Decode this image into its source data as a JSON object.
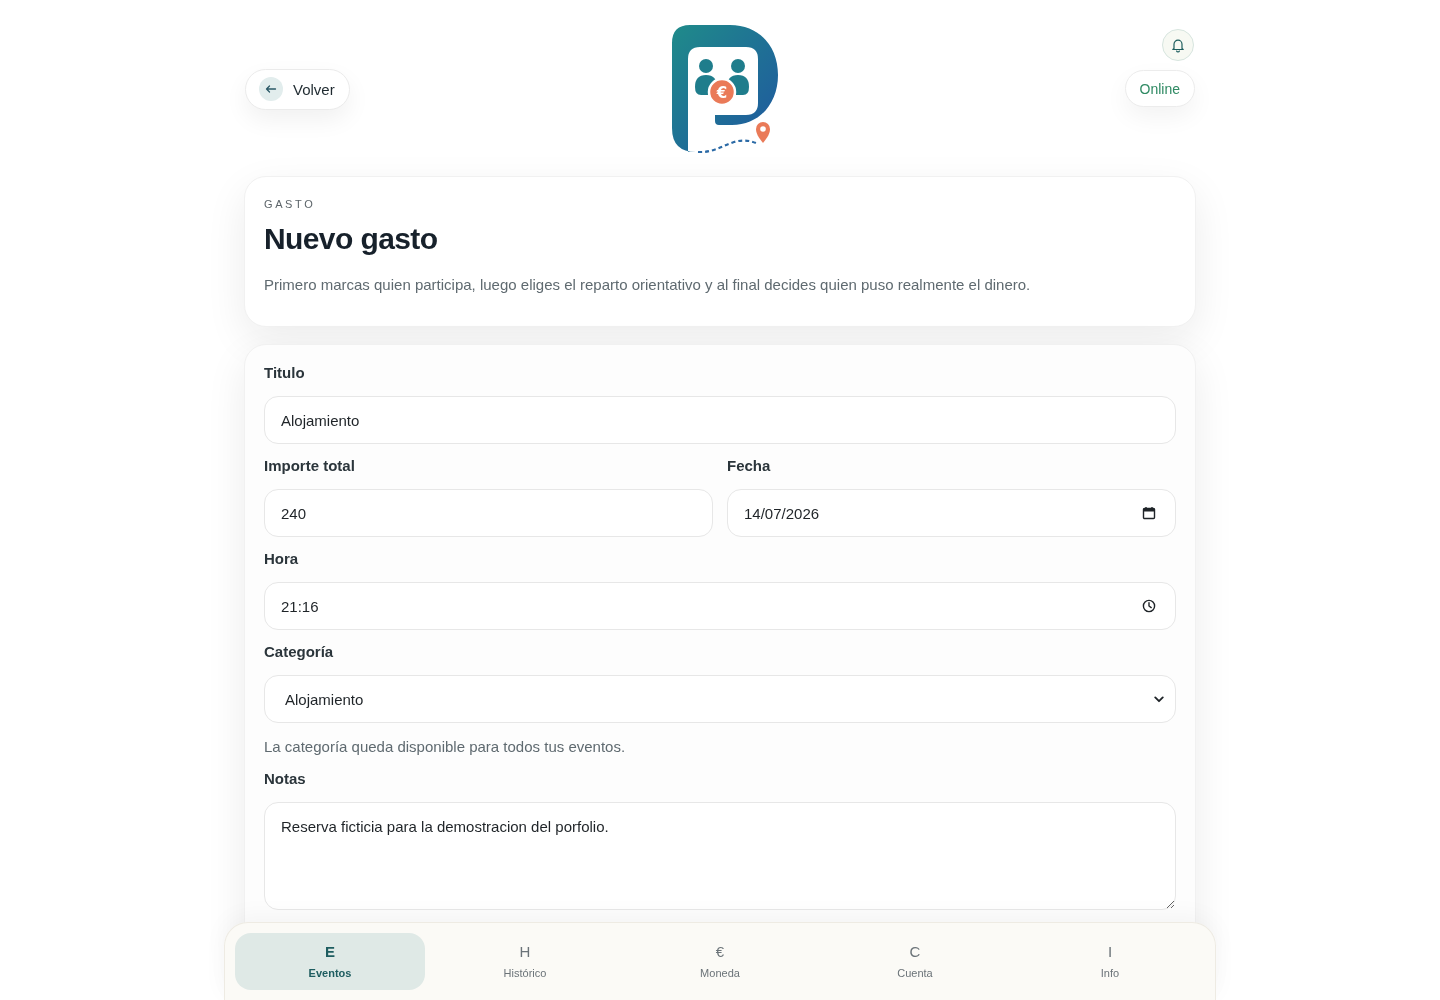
{
  "header": {
    "back_button": {
      "label": "Volver"
    },
    "logo": {
      "symbol": "€"
    },
    "status": {
      "label": "Online"
    }
  },
  "intro": {
    "eyebrow": "GASTO",
    "title": "Nuevo gasto",
    "description": "Primero marcas quien participa, luego eliges el reparto orientativo y al final decides quien puso realmente el dinero."
  },
  "form": {
    "rows": [
      {
        "fields": [
          {
            "kind": "text",
            "label": "Titulo",
            "value": "Alojamiento"
          }
        ]
      },
      {
        "fields": [
          {
            "kind": "text",
            "label": "Importe total",
            "value": "240"
          },
          {
            "kind": "date",
            "label": "Fecha",
            "value": "14/07/2026"
          }
        ]
      },
      {
        "fields": [
          {
            "kind": "time",
            "label": "Hora",
            "value": "21:16"
          }
        ]
      },
      {
        "fields": [
          {
            "kind": "select",
            "label": "Categoría",
            "value": "Alojamiento",
            "hint": "La categoría queda disponible para todos tus eventos."
          }
        ]
      },
      {
        "fields": [
          {
            "kind": "textarea",
            "label": "Notas",
            "value": "Reserva ficticia para la demostracion del porfolio."
          }
        ]
      }
    ]
  },
  "bottom_nav": [
    {
      "glyph": "E",
      "label": "Eventos",
      "selected": true
    },
    {
      "glyph": "H",
      "label": "Histórico",
      "selected": false
    },
    {
      "glyph": "€",
      "label": "Moneda",
      "selected": false
    },
    {
      "glyph": "C",
      "label": "Cuenta",
      "selected": false
    },
    {
      "glyph": "I",
      "label": "Info",
      "selected": false
    }
  ]
}
